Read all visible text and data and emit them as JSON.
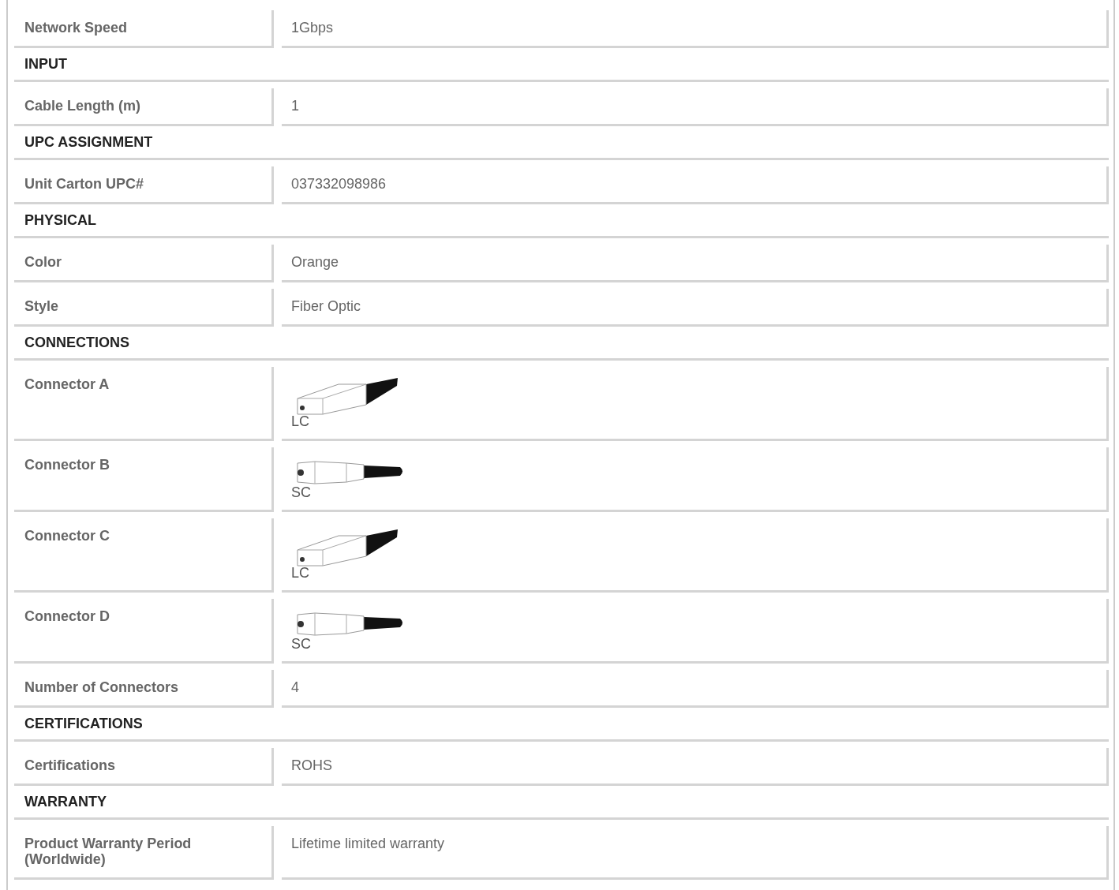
{
  "sections": [
    {
      "rows": [
        {
          "kind": "text",
          "label": "Network Speed",
          "value": "1Gbps"
        }
      ]
    },
    {
      "title": "INPUT",
      "rows": [
        {
          "kind": "text",
          "label": "Cable Length (m)",
          "value": "1"
        }
      ]
    },
    {
      "title": "UPC ASSIGNMENT",
      "rows": [
        {
          "kind": "text",
          "label": "Unit Carton UPC#",
          "value": "037332098986"
        }
      ]
    },
    {
      "title": "PHYSICAL",
      "rows": [
        {
          "kind": "text",
          "label": "Color",
          "value": "Orange"
        },
        {
          "kind": "text",
          "label": "Style",
          "value": "Fiber Optic"
        }
      ]
    },
    {
      "title": "CONNECTIONS",
      "rows": [
        {
          "kind": "lc",
          "label": "Connector A",
          "value": "LC"
        },
        {
          "kind": "sc",
          "label": "Connector B",
          "value": "SC"
        },
        {
          "kind": "lc",
          "label": "Connector C",
          "value": "LC"
        },
        {
          "kind": "sc",
          "label": "Connector D",
          "value": "SC"
        },
        {
          "kind": "text",
          "label": "Number of Connectors",
          "value": "4"
        }
      ]
    },
    {
      "title": "CERTIFICATIONS",
      "rows": [
        {
          "kind": "text",
          "label": "Certifications",
          "value": "ROHS"
        }
      ]
    },
    {
      "title": "WARRANTY",
      "rows": [
        {
          "kind": "text",
          "label": "Product Warranty Period (Worldwide)",
          "value": "Lifetime limited warranty"
        }
      ]
    }
  ]
}
